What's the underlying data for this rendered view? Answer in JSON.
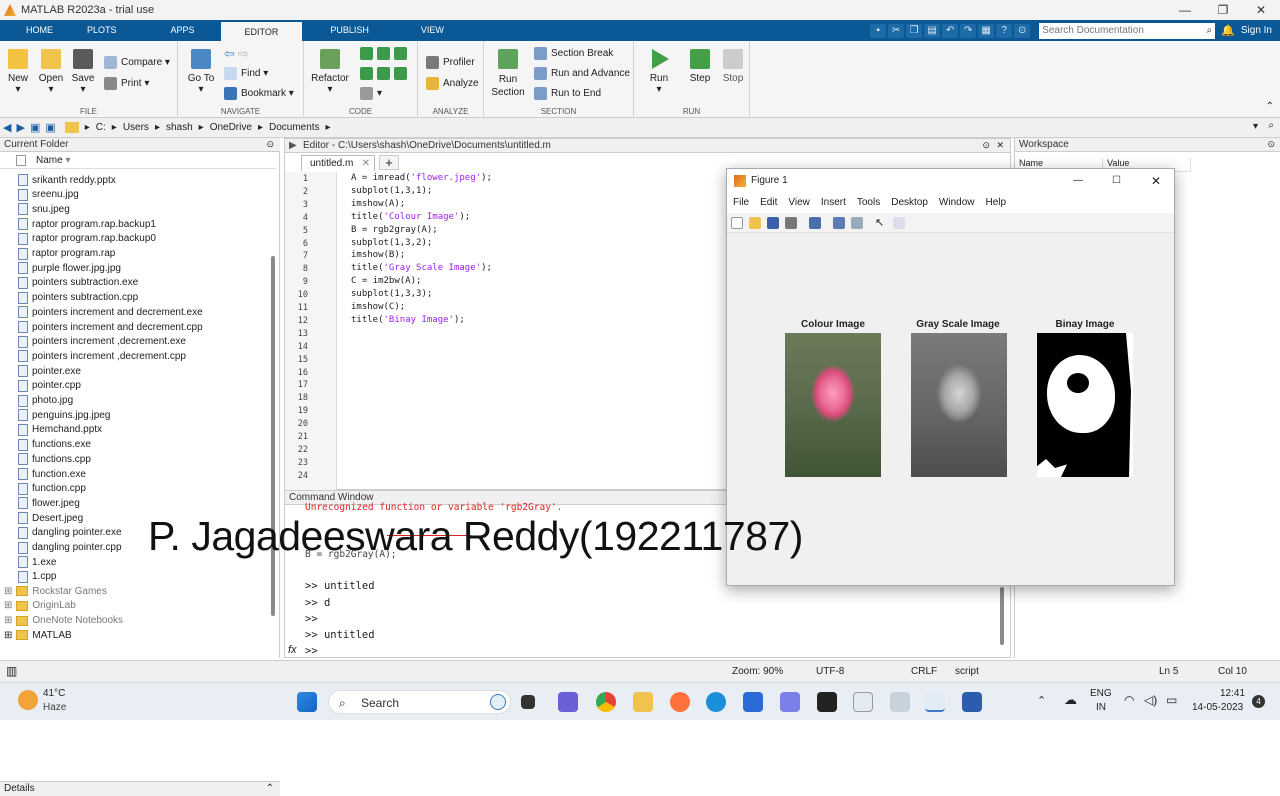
{
  "window": {
    "title": "MATLAB R2023a - trial use",
    "min": "—",
    "max": "❐",
    "close": "✕"
  },
  "tabs": [
    "HOME",
    "PLOTS",
    "APPS",
    "EDITOR",
    "PUBLISH",
    "VIEW"
  ],
  "search": {
    "placeholder": "Search Documentation"
  },
  "signin": "Sign In",
  "ribbon": {
    "file": {
      "label": "FILE",
      "new": "New",
      "open": "Open",
      "save": "Save",
      "compare": "Compare",
      "print": "Print"
    },
    "navigate": {
      "label": "NAVIGATE",
      "goto": "Go To",
      "find": "Find",
      "bookmark": "Bookmark"
    },
    "code": {
      "label": "CODE",
      "refactor": "Refactor"
    },
    "analyze": {
      "label": "ANALYZE",
      "profiler": "Profiler",
      "analyze": "Analyze"
    },
    "section": {
      "label": "SECTION",
      "run_section": "Run Section",
      "section_break": "Section Break",
      "run_advance": "Run and Advance",
      "run_end": "Run to End"
    },
    "run": {
      "label": "RUN",
      "run": "Run",
      "step": "Step",
      "stop": "Stop"
    }
  },
  "path": [
    "C:",
    "Users",
    "shash",
    "OneDrive",
    "Documents"
  ],
  "current_folder": {
    "title": "Current Folder",
    "column": "Name",
    "files": [
      "srikanth reddy.pptx",
      "sreenu.jpg",
      "snu.jpeg",
      "raptor program.rap.backup1",
      "raptor program.rap.backup0",
      "raptor program.rap",
      "purple flower.jpg.jpg",
      "pointers subtraction.exe",
      "pointers subtraction.cpp",
      "pointers increment and decrement.exe",
      "pointers increment and decrement.cpp",
      "pointers increment ,decrement.exe",
      "pointers increment ,decrement.cpp",
      "pointer.exe",
      "pointer.cpp",
      "photo.jpg",
      "penguins.jpg.jpeg",
      "Hemchand.pptx",
      "functions.exe",
      "functions.cpp",
      "function.exe",
      "function.cpp",
      "flower.jpeg",
      "Desert.jpeg",
      "dangling pointer.exe",
      "dangling pointer.cpp",
      "1.exe",
      "1.cpp"
    ],
    "folders": [
      "Rockstar Games",
      "OriginLab",
      "OneNote Notebooks",
      "MATLAB"
    ],
    "details": "Details"
  },
  "editor": {
    "title": "Editor - C:\\Users\\shash\\OneDrive\\Documents\\untitled.m",
    "tab": "untitled.m",
    "plus": "+",
    "line_numbers": [
      "1",
      "2",
      "3",
      "4",
      "5",
      "6",
      "7",
      "8",
      "9",
      "10",
      "11",
      "12",
      "13",
      "14",
      "15",
      "16",
      "17",
      "18",
      "19",
      "20",
      "21",
      "22",
      "23",
      "24"
    ],
    "code": [
      {
        "pre": "A = imread(",
        "str": "'flower.jpeg'",
        "post": ");"
      },
      {
        "pre": "subplot(1,3,1);",
        "str": "",
        "post": ""
      },
      {
        "pre": "imshow(A);",
        "str": "",
        "post": ""
      },
      {
        "pre": "title(",
        "str": "'Colour Image'",
        "post": ");"
      },
      {
        "pre": "B = rgb2gray(A);",
        "str": "",
        "post": ""
      },
      {
        "pre": "subplot(1,3,2);",
        "str": "",
        "post": ""
      },
      {
        "pre": "imshow(B);",
        "str": "",
        "post": ""
      },
      {
        "pre": "title(",
        "str": "'Gray Scale Image'",
        "post": ");"
      },
      {
        "pre": "C = im2bw(A);",
        "str": "",
        "post": ""
      },
      {
        "pre": "subplot(1,3,3);",
        "str": "",
        "post": ""
      },
      {
        "pre": "imshow(C);",
        "str": "",
        "post": ""
      },
      {
        "pre": "title(",
        "str": "'Binay Image'",
        "post": ");"
      }
    ]
  },
  "command_window": {
    "title": "Command Window",
    "lines": [
      "Unrecognized function or variable 'rgb2Gray'.",
      "B = rgb2Gray(A);",
      ">> untitled",
      ">> d",
      ">>",
      ">> untitled",
      ">>"
    ],
    "fx": "fx"
  },
  "workspace": {
    "title": "Workspace",
    "col_name": "Name",
    "col_value": "Value"
  },
  "figure": {
    "title": "Figure 1",
    "menu": [
      "File",
      "Edit",
      "View",
      "Insert",
      "Tools",
      "Desktop",
      "Window",
      "Help"
    ],
    "subplots": [
      "Colour Image",
      "Gray Scale Image",
      "Binay Image"
    ]
  },
  "watermark": "P. Jagadeeswara Reddy(192211787)",
  "status": {
    "zoom": "Zoom: 90%",
    "encoding": "UTF-8",
    "eol": "CRLF",
    "type": "script",
    "ln": "Ln  5",
    "col": "Col  10"
  },
  "taskbar": {
    "weather_temp": "41°C",
    "weather_desc": "Haze",
    "search": "Search",
    "lang": "ENG",
    "region": "IN",
    "time": "12:41",
    "date": "14-05-2023",
    "notif_count": "4"
  }
}
